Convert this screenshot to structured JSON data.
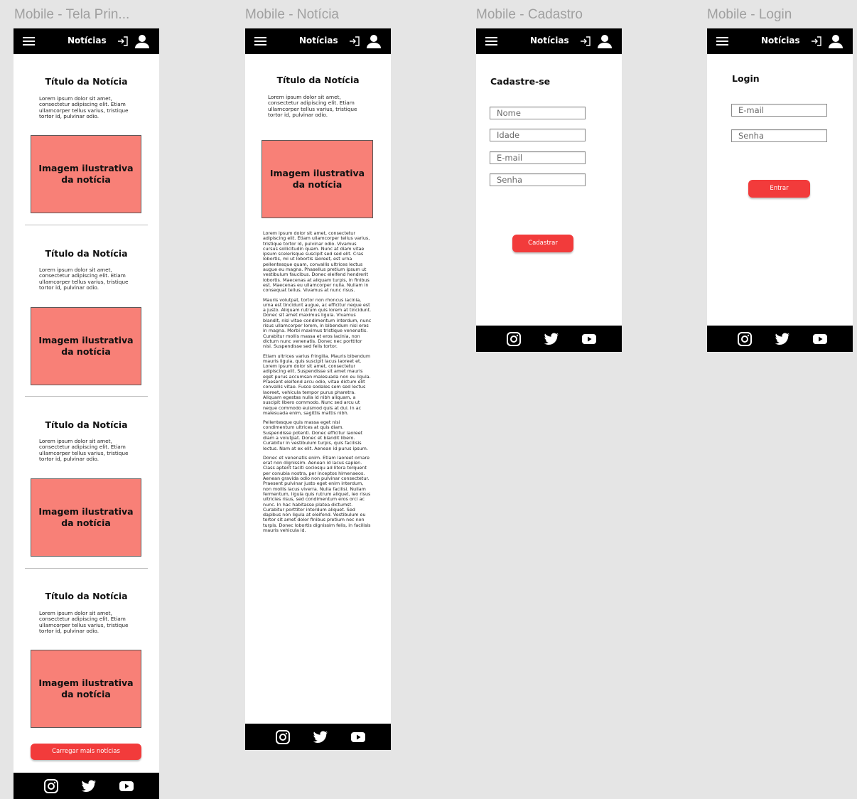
{
  "frames": {
    "home": {
      "label": "Mobile - Tela Prin..."
    },
    "article": {
      "label": "Mobile - Notícia"
    },
    "signup": {
      "label": "Mobile - Cadastro"
    },
    "login": {
      "label": "Mobile - Login"
    }
  },
  "nav": {
    "title": "Notícias"
  },
  "icons": {
    "menu": "hamburger-icon",
    "login": "login-icon",
    "user": "user-icon",
    "instagram": "instagram-icon",
    "twitter": "twitter-icon",
    "youtube": "youtube-icon"
  },
  "colors": {
    "accent": "#f23b3b",
    "image_placeholder": "#f88077",
    "bar": "#000000"
  },
  "home": {
    "cards": [
      {
        "title": "Título da Notícia",
        "summary": "Lorem ipsum dolor sit amet, consectetur adipiscing elit. Etiam ullamcorper tellus varius, tristique tortor id, pulvinar odio.",
        "image_label": "Imagem ilustrativa da notícia"
      },
      {
        "title": "Título da Notícia",
        "summary": "Lorem ipsum dolor sit amet, consectetur adipiscing elit. Etiam ullamcorper tellus varius, tristique tortor id, pulvinar odio.",
        "image_label": "Imagem ilustrativa da notícia"
      },
      {
        "title": "Título da Notícia",
        "summary": "Lorem ipsum dolor sit amet, consectetur adipiscing elit. Etiam ullamcorper tellus varius, tristique tortor id, pulvinar odio.",
        "image_label": "Imagem ilustrativa da notícia"
      },
      {
        "title": "Título da Notícia",
        "summary": "Lorem ipsum dolor sit amet, consectetur adipiscing elit. Etiam ullamcorper tellus varius, tristique tortor id, pulvinar odio.",
        "image_label": "Imagem ilustrativa da notícia"
      }
    ],
    "load_more": "Carregar mais notícias"
  },
  "article": {
    "title": "Título da Notícia",
    "summary": "Lorem ipsum dolor sit amet, consectetur adipiscing elit. Etiam ullamcorper tellus varius, tristique tortor id, pulvinar odio.",
    "image_label": "Imagem ilustrativa da notícia",
    "paragraphs": [
      "Lorem ipsum dolor sit amet, consectetur adipiscing elit. Etiam ullamcorper tellus varius, tristique tortor id, pulvinar odio. Vivamus cursus sollicitudin quam. Nunc at diam vitae ipsum scelerisque suscipit sed sed elit. Cras lobortis, mi ut lobortis laoreet, est urna pellentesque quam, convallis ultrices lectus augue eu magna. Phasellus pretium ipsum ut vestibulum faucibus. Donec eleifend hendrerit lobortis. Maecenas at aliquam turpis, in finibus est. Maecenas eu ullamcorper nulla. Nullam in consequat tellus. Vivamus at nunc risus.",
      "Mauris volutpat, tortor non rhoncus lacinia, urna est tincidunt augue, ac efficitur neque est a justo. Aliquam rutrum quis lorem at tincidunt. Donec sit amet maximus ligula. Vivamus blandit, nisi vitae condimentum interdum, nunc risus ullamcorper lorem, in bibendum nisi eros in magna. Morbi maximus tristique venenatis. Curabitur mollis massa et eros lacinia, non dictum nunc venenatis. Donec nec porttitor nisi. Suspendisse sed felis tortor.",
      "Etiam ultrices varius fringilla. Mauris bibendum mauris ligula, quis suscipit lacus laoreet et. Lorem ipsum dolor sit amet, consectetur adipiscing elit. Suspendisse sit amet mauris eget purus accumsan malesuada non eu ligula. Praesent eleifend arcu odio, vitae dictum elit convallis vitae. Fusce sodales sem sed lectus laoreet, vehicula tempor purus pharetra. Aliquam egestas nulla id nibh aliquam, a suscipit libero commodo. Nunc sed arcu ut neque commodo euismod quis at dui. In ac malesuada enim, sagittis mattis nibh.",
      "Pellentesque quis massa eget nisi condimentum ultrices at quis diam. Suspendisse potenti. Donec efficitur laoreet diam a volutpat. Donec et blandit libero. Curabitur in vestibulum turpis, quis facilisis lectus. Nam at ex elit. Aenean id purus ipsum.",
      "Donec et venenatis enim. Etiam laoreet ornare erat non dignissim. Aenean id lacus sapien. Class aptent taciti sociosqu ad litora torquent per conubia nostra, per inceptos himenaeos. Aenean gravida odio non pulvinar consectetur. Praesent pulvinar justo eget enim interdum, non mollis lacus viverra. Nulla facilisi. Nullam fermentum, ligula quis rutrum aliquet, leo risus ultricies risus, sed condimentum eros orci ac nunc. In hac habitasse platea dictumst. Curabitur porttitor interdum aliquet. Sed dapibus non ligula at eleifend. Vestibulum eu tortor sit amet dolor finibus pretium nec non turpis. Donec lobortis dignissim felis, in facilisis mauris vehicula id."
    ]
  },
  "signup": {
    "title": "Cadastre-se",
    "fields": [
      {
        "placeholder": "Nome"
      },
      {
        "placeholder": "Idade"
      },
      {
        "placeholder": "E-mail"
      },
      {
        "placeholder": "Senha"
      }
    ],
    "submit": "Cadastrar"
  },
  "login": {
    "title": "Login",
    "fields": [
      {
        "placeholder": "E-mail"
      },
      {
        "placeholder": "Senha"
      }
    ],
    "submit": "Entrar"
  }
}
